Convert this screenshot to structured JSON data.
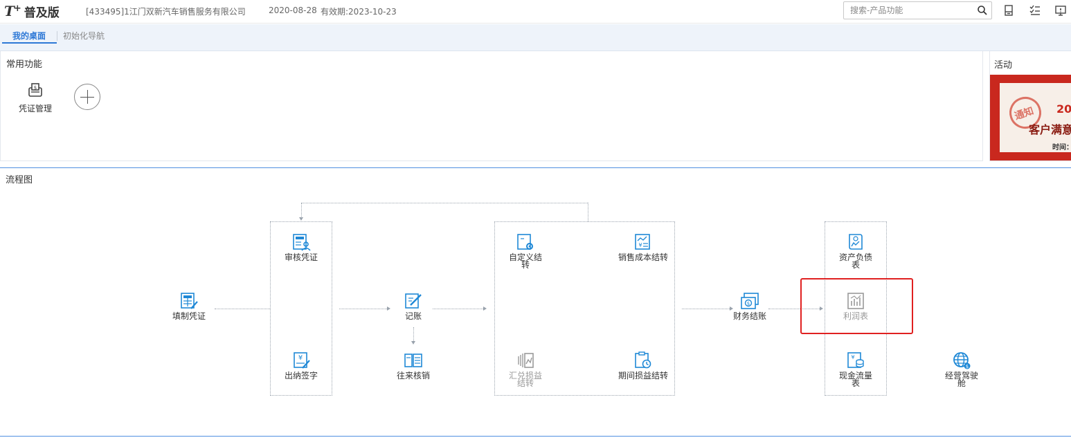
{
  "header": {
    "logo_t": "T",
    "logo_plus": "+",
    "logo_edition": "普及版",
    "company": "[433495]1江门双新汽车销售服务有限公司",
    "date": "2020-08-28",
    "validity": "有效期:2023-10-23",
    "search_placeholder": "搜索-产品功能"
  },
  "tabs": [
    {
      "label": "我的桌面",
      "active": true
    },
    {
      "label": "初始化导航",
      "active": false
    }
  ],
  "common_functions": {
    "title": "常用功能",
    "items": [
      {
        "label": "凭证管理",
        "icon": "voucher-manage-icon"
      }
    ]
  },
  "activity": {
    "title": "活动",
    "banner": {
      "stamp": "通知",
      "year_text": "20",
      "headline": "客户满意",
      "time_text": "时间：2("
    }
  },
  "flow": {
    "title": "流程图",
    "nodes": {
      "fill_voucher": "填制凭证",
      "audit_voucher": "审核凭证",
      "cashier_sign": "出纳签字",
      "bookkeeping": "记账",
      "reconcile": "往来核销",
      "custom_transfer": "自定义结转",
      "sales_cost_transfer": "销售成本结转",
      "fx_gain_loss": "汇兑损益结转",
      "period_profit_loss": "期间损益结转",
      "closing": "财务结账",
      "balance_sheet": "资产负债表",
      "income_statement": "利润表",
      "cash_flow": "现金流量表",
      "business_cockpit": "经营驾驶舱"
    }
  },
  "colors": {
    "accent": "#2d78d6",
    "icon_blue": "#1e88d6",
    "icon_gray": "#999999",
    "highlight_red": "#e02020"
  }
}
